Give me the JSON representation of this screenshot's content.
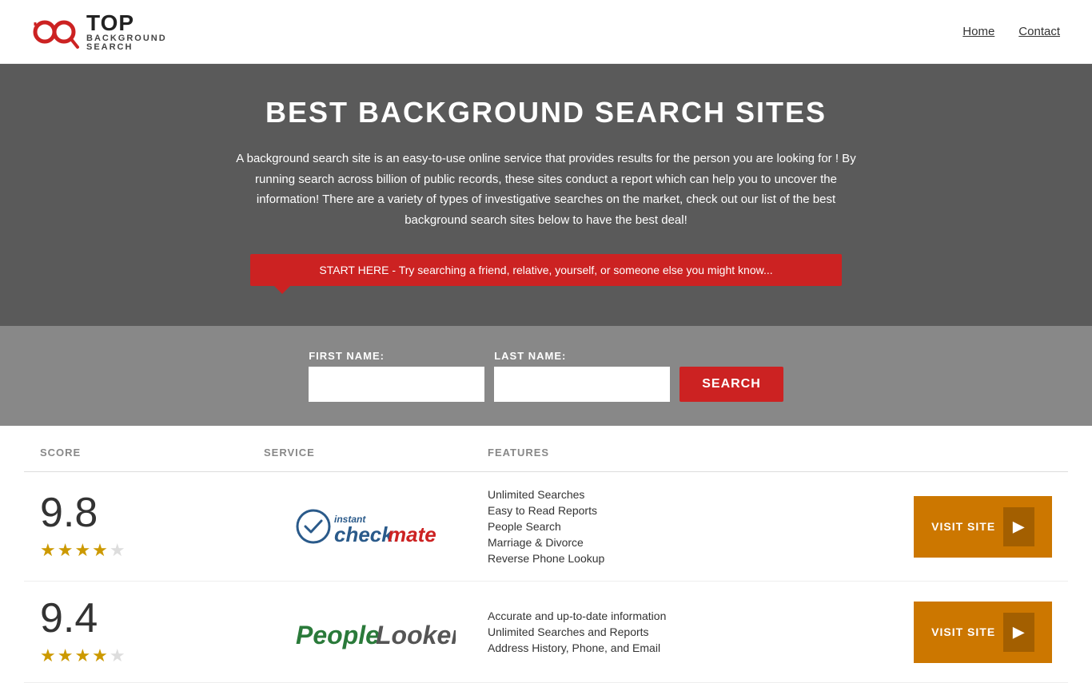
{
  "header": {
    "logo_top": "TOP",
    "logo_sub": "BACKGROUND\nSEARCH",
    "nav": [
      {
        "label": "Home",
        "id": "home"
      },
      {
        "label": "Contact",
        "id": "contact"
      }
    ]
  },
  "hero": {
    "title": "BEST BACKGROUND SEARCH SITES",
    "description": "A background search site is an easy-to-use online service that provides results  for the person you are looking for ! By  running  search across billion of public records, these sites conduct  a report which can help you to uncover the information! There are a variety of types of investigative searches on the market, check out our  list of the best background search sites below to have the best deal!",
    "prompt": "START HERE - Try searching a friend, relative, yourself, or someone else you might know..."
  },
  "search_form": {
    "first_name_label": "FIRST NAME:",
    "last_name_label": "LAST NAME:",
    "first_name_placeholder": "",
    "last_name_placeholder": "",
    "search_button_label": "SEARCH"
  },
  "results_table": {
    "headers": {
      "score": "SCORE",
      "service": "SERVICE",
      "features": "FEATURES"
    },
    "rows": [
      {
        "score": "9.8",
        "stars": 4.5,
        "star_display": "★★★★★",
        "service_name": "Instant Checkmate",
        "service_type": "checkmate",
        "features": [
          "Unlimited Searches",
          "Easy to Read Reports",
          "People Search",
          "Marriage & Divorce",
          "Reverse Phone Lookup"
        ],
        "visit_label": "VISIT SITE",
        "visit_url": "#"
      },
      {
        "score": "9.4",
        "stars": 4.5,
        "star_display": "★★★★★",
        "service_name": "PeopleLooker",
        "service_type": "peoplelooker",
        "features": [
          "Accurate and up-to-date information",
          "Unlimited Searches and Reports",
          "Address History, Phone, and Email"
        ],
        "visit_label": "VISIT SITE",
        "visit_url": "#"
      }
    ]
  },
  "colors": {
    "accent_red": "#cc2222",
    "accent_orange": "#cc7700",
    "logo_blue": "#2a5a8a",
    "people_green": "#2a7a3a",
    "hero_bg": "#5a5a5a",
    "form_bg": "#888888"
  }
}
